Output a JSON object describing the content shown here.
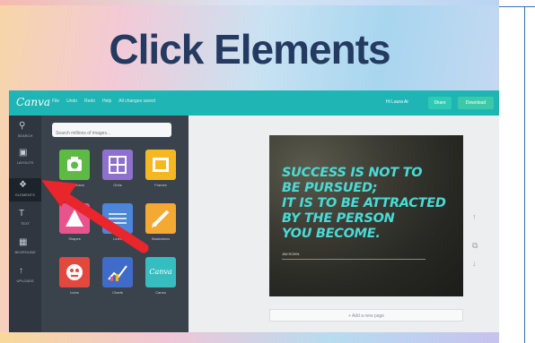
{
  "slide": {
    "title": "Click Elements"
  },
  "app": {
    "logo": "Canva",
    "menu": [
      "File",
      "Undo",
      "Redo",
      "Help",
      "All changes saved"
    ],
    "user": "Hi Laura Ar",
    "share_label": "Share",
    "download_label": "Download"
  },
  "sidebar": {
    "items": [
      {
        "label": "SEARCH",
        "icon": "search-icon"
      },
      {
        "label": "LAYOUTS",
        "icon": "layouts-icon"
      },
      {
        "label": "ELEMENTS",
        "icon": "elements-icon"
      },
      {
        "label": "TEXT",
        "icon": "text-icon"
      },
      {
        "label": "BKGROUND",
        "icon": "background-icon"
      },
      {
        "label": "UPLOADS",
        "icon": "uploads-icon"
      }
    ]
  },
  "panel": {
    "search_placeholder": "Search millions of images...",
    "tiles": [
      {
        "label": "Free Photos",
        "color": "#5dbb45",
        "icon": "camera-icon"
      },
      {
        "label": "Grids",
        "color": "#8f6fd0",
        "icon": "grid-icon"
      },
      {
        "label": "Frames",
        "color": "#f5b823",
        "icon": "frame-icon"
      },
      {
        "label": "Shapes",
        "color": "#e8538c",
        "icon": "shape-icon"
      },
      {
        "label": "Lines",
        "color": "#4c86d8",
        "icon": "lines-icon"
      },
      {
        "label": "Illustrations",
        "color": "#f4a932",
        "icon": "pencil-icon"
      },
      {
        "label": "Icons",
        "color": "#e4473e",
        "icon": "icons-icon"
      },
      {
        "label": "Charts",
        "color": "#3f6cc9",
        "icon": "chart-icon"
      },
      {
        "label": "Canva",
        "color": "#36bdc0",
        "icon": "canva-icon"
      }
    ]
  },
  "design": {
    "quote_lines": [
      "SUCCESS IS NOT TO",
      "BE PURSUED;",
      "IT IS TO BE ATTRACTED",
      "BY THE PERSON",
      "YOU BECOME."
    ],
    "author": "JIM ROHN",
    "add_page_label": "+ Add a new page"
  },
  "colors": {
    "title": "#243a61",
    "topbar": "#1fb5b4",
    "quote": "#49dbd6",
    "arrow": "#e8262b"
  }
}
